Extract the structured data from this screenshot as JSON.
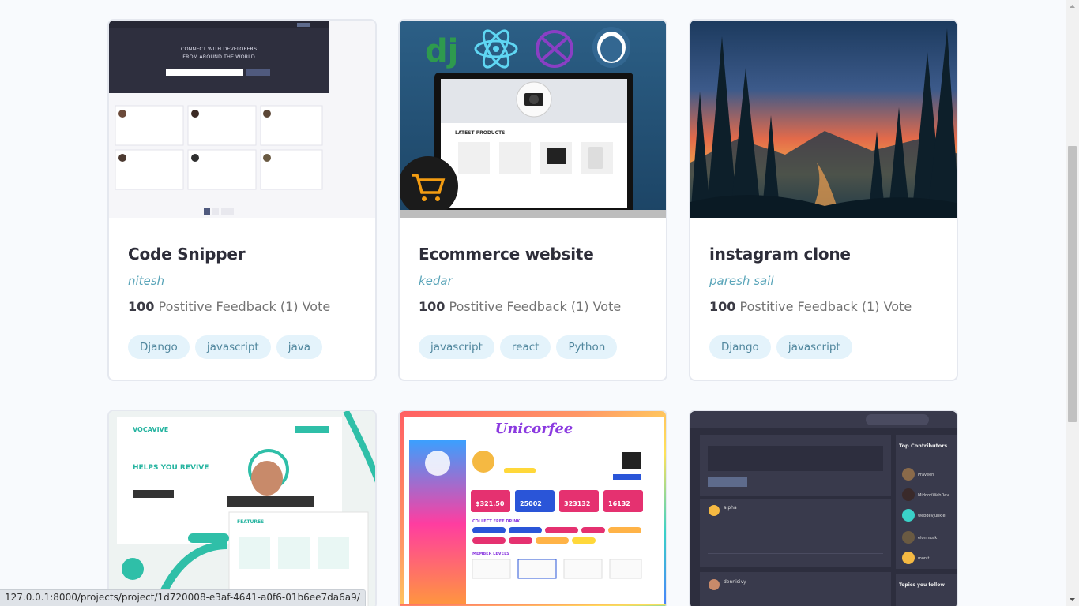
{
  "projects": [
    {
      "title": "Code Snipper",
      "author": "nitesh",
      "feedback_value": "100",
      "feedback_text": "Postitive Feedback (1) Vote",
      "tags": [
        "Django",
        "javascript",
        "java"
      ],
      "thumb_lines": [
        "CONNECT WITH DEVELOPERS",
        "FROM AROUND THE WORLD"
      ]
    },
    {
      "title": "Ecommerce website",
      "author": "kedar",
      "feedback_value": "100",
      "feedback_text": "Postitive Feedback (1) Vote",
      "tags": [
        "javascript",
        "react",
        "Python"
      ],
      "thumb_lines": [
        "LATEST PRODUCTS"
      ]
    },
    {
      "title": "instagram clone",
      "author": "paresh sail",
      "feedback_value": "100",
      "feedback_text": "Postitive Feedback (1) Vote",
      "tags": [
        "Django",
        "javascript"
      ],
      "thumb_lines": []
    },
    {
      "title": "",
      "author": "",
      "feedback_value": "",
      "feedback_text": "",
      "tags": [],
      "thumb_lines": [
        "VOCAVIVE",
        "HELPS YOU REVIVE",
        "FEATURES"
      ]
    },
    {
      "title": "",
      "author": "",
      "feedback_value": "",
      "feedback_text": "",
      "tags": [],
      "thumb_lines": [
        "Unicorfee",
        "$321.50",
        "25002",
        "323132",
        "16132",
        "COLLECT FREE DRINK",
        "MEMBER LEVELS"
      ]
    },
    {
      "title": "",
      "author": "",
      "feedback_value": "",
      "feedback_text": "",
      "tags": [],
      "thumb_lines": [
        "Top Contributors",
        "Praveen",
        "MiddoriWebDev",
        "webdevjunkie",
        "elonmusk",
        "monit",
        "Topics you follow",
        "alpha",
        "dennisivy"
      ]
    }
  ],
  "status_bar": {
    "url": "127.0.0.1:8000/projects/project/1d720008-e3af-4641-a0f6-01b6ee7da6a9/"
  },
  "colors": {
    "background": "#f8fafd",
    "tag_bg": "#e4f3fb",
    "tag_text": "#51879e",
    "author": "#5aa5b9"
  }
}
